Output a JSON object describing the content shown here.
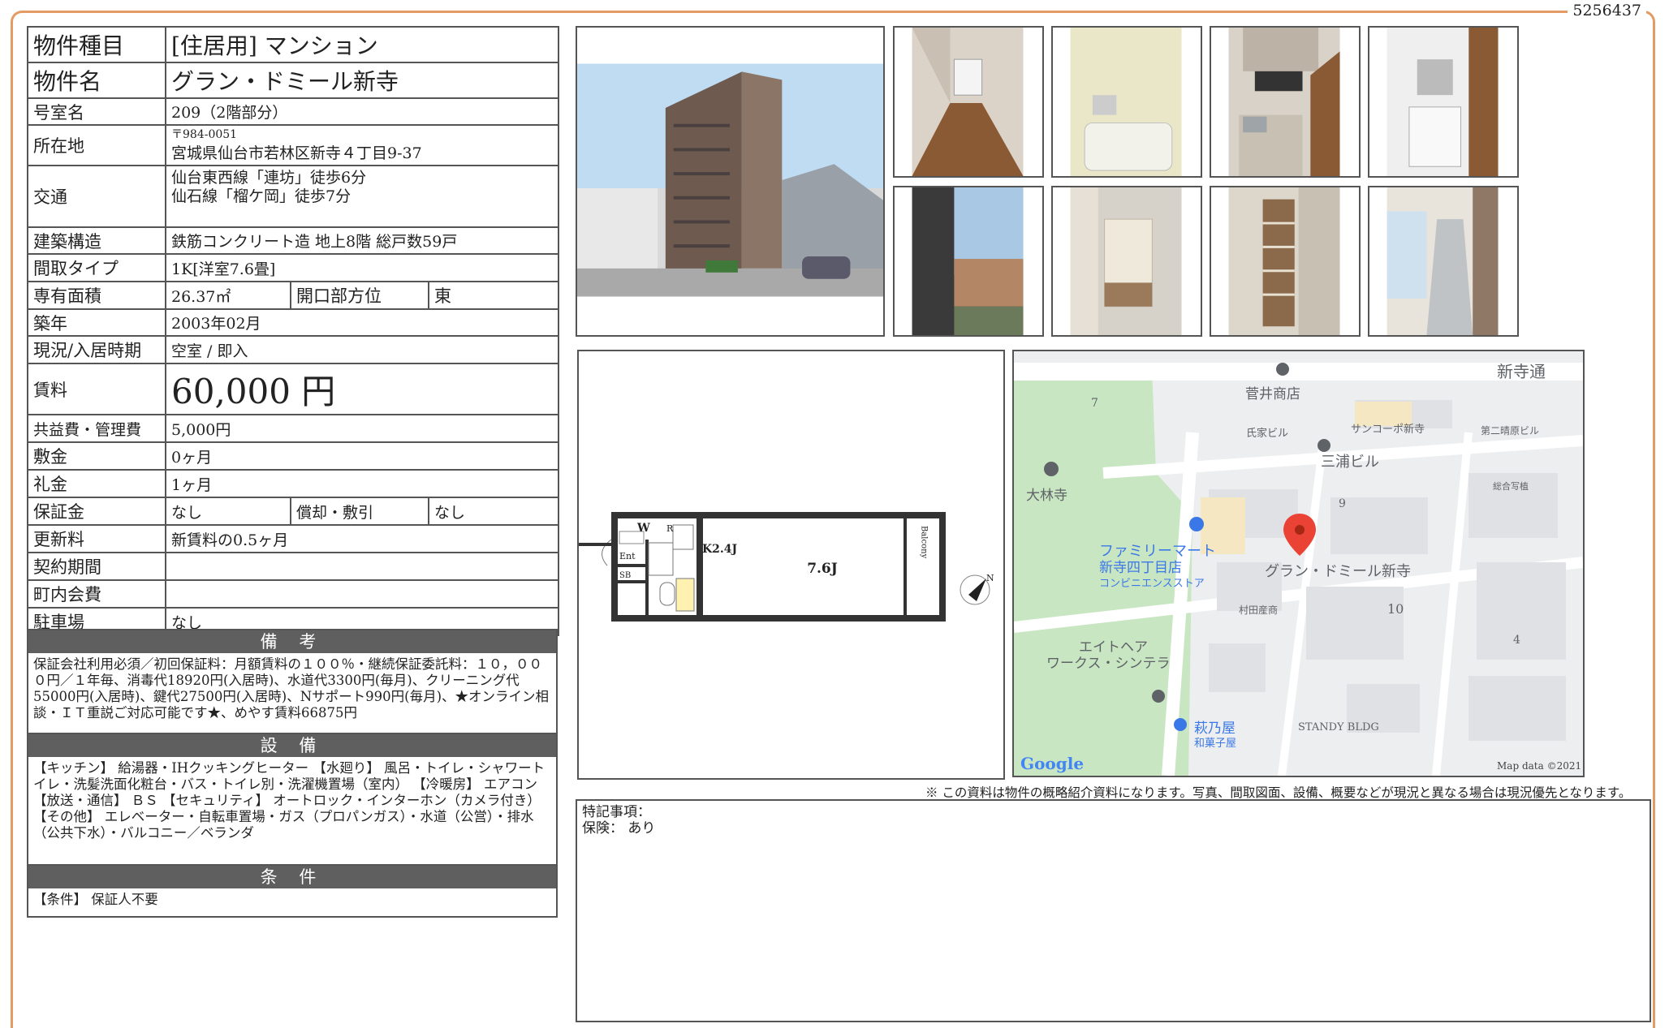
{
  "doc_id": "5256437",
  "spec": {
    "type_label": "物件種目",
    "type_value": "[住居用] マンション",
    "name_label": "物件名",
    "name_value": "グラン・ドミール新寺",
    "room_label": "号室名",
    "room_value": "209（2階部分）",
    "address_label": "所在地",
    "postal": "〒984-0051",
    "address": "宮城県仙台市若林区新寺４丁目9-37",
    "access_label": "交通",
    "access_1": "仙台東西線「連坊」徒歩6分",
    "access_2": "仙石線「榴ケ岡」徒歩7分",
    "structure_label": "建築構造",
    "structure_value": "鉄筋コンクリート造 地上8階 総戸数59戸",
    "layout_label": "間取タイプ",
    "layout_value": "1K[洋室7.6畳]",
    "area_label": "専有面積",
    "area_value": "26.37㎡",
    "direction_label": "開口部方位",
    "direction_value": "東",
    "built_label": "築年",
    "built_value": "2003年02月",
    "status_label": "現況/入居時期",
    "status_value": "空室 / 即入",
    "rent_label": "賃料",
    "rent_value": "60,000 円",
    "fee_label": "共益費・管理費",
    "fee_value": "5,000円",
    "deposit_label": "敷金",
    "deposit_value": "0ヶ月",
    "key_label": "礼金",
    "key_value": "1ヶ月",
    "guarantee_label": "保証金",
    "guarantee_value": "なし",
    "amort_label": "償却・敷引",
    "amort_value": "なし",
    "renewal_label": "更新料",
    "renewal_value": "新賃料の0.5ヶ月",
    "contract_label": "契約期間",
    "contract_value": "",
    "town_label": "町内会費",
    "town_value": "",
    "parking_label": "駐車場",
    "parking_value": "なし"
  },
  "remarks": {
    "title": "備 考",
    "body": "保証会社利用必須／初回保証料：月額賃料の１００％・継続保証委託料：１０，０００円／１年毎、消毒代18920円(入居時)、水道代3300円(毎月)、クリーニング代55000円(入居時)、鍵代27500円(入居時)、Nサポート990円(毎月)、★オンライン相談・ＩＴ重説ご対応可能です★、めやす賃料66875円"
  },
  "facilities": {
    "title": "設 備",
    "body": "【キッチン】 給湯器・IHクッキングヒーター 【水廻り】 風呂・トイレ・シャワートイレ・洗髪洗面化粧台・バス・トイレ別・洗濯機置場（室内） 【冷暖房】 エアコン 【放送・通信】 ＢＳ 【セキュリティ】 オートロック・インターホン（カメラ付き） 【その他】 エレベーター・自転車置場・ガス（プロパンガス）・水道（公営）・排水（公共下水）・バルコニー／ベランダ"
  },
  "conditions": {
    "title": "条 件",
    "body": "【条件】 保証人不要"
  },
  "floorplan": {
    "room": "7.6J",
    "kitchen": "K2.4J",
    "w": "W",
    "r": "R",
    "ent": "Ent",
    "sb": "SB",
    "balcony": "Balcony",
    "north": "N"
  },
  "map": {
    "road": "新寺通",
    "s1": "菅井商店",
    "s2": "サンコーポ新寺",
    "s3": "氏家ビル",
    "s4": "三浦ビル",
    "s5": "第二晴原ビル",
    "s6": "大林寺",
    "s7": "総合写植",
    "s8": "ファミリーマート",
    "s9": "新寺四丁目店",
    "s10": "コンビニエンスストア",
    "s11": "グラン・ドミール新寺",
    "s12": "村田産商",
    "s13": "エイトヘア",
    "s14": "ワークス・シンテラ",
    "s15": "萩乃屋",
    "s16": "和菓子屋",
    "s17": "STANDY BLDG",
    "n7": "7",
    "n9": "9",
    "n10": "10",
    "n4": "4",
    "logo": "Google",
    "credit": "Map data ©2021"
  },
  "note": "※ この資料は物件の概略紹介資料になります。写真、間取図面、設備、概要などが現況と異なる場合は現況優先となります。",
  "special": {
    "line1": "特記事項：",
    "line2": "保険： あり"
  }
}
